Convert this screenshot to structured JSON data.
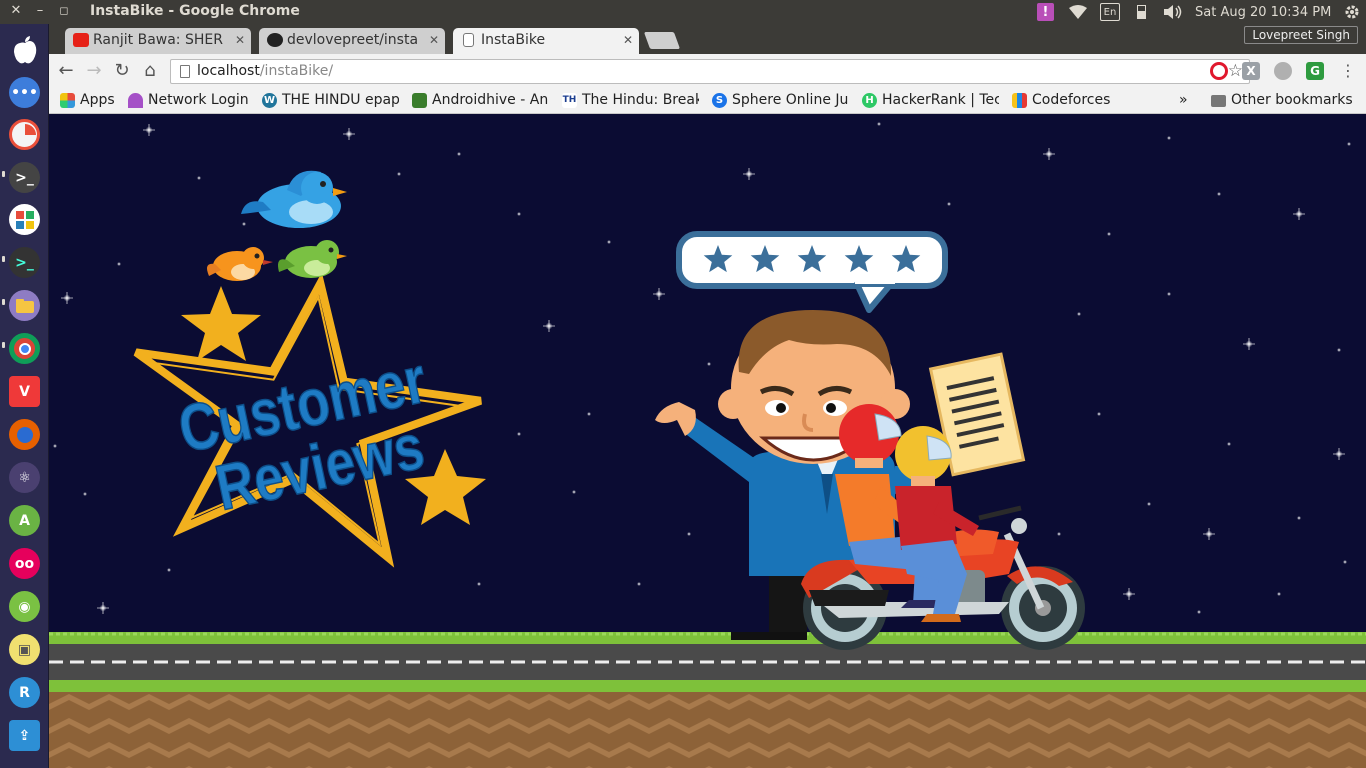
{
  "system": {
    "window_title": "InstaBike - Google Chrome",
    "indicator_alert": "!",
    "keyboard_layout": "En",
    "clock": "Sat Aug 20 10:34 PM"
  },
  "launcher": {
    "apps": [
      "apple-logo",
      "more-apps",
      "pie-app",
      "terminal",
      "app-grid",
      "terminal-alt",
      "files",
      "chrome",
      "vivaldi",
      "firefox",
      "atom",
      "android-studio",
      "flickr",
      "robot-app",
      "image-viewer",
      "refresh-app",
      "upload-app"
    ]
  },
  "tabs": [
    {
      "title": "Ranjit Bawa: SHER",
      "icon": "youtube-icon",
      "active": false
    },
    {
      "title": "devlovepreet/insta",
      "icon": "github-icon",
      "active": false
    },
    {
      "title": "InstaBike",
      "icon": "page-icon",
      "active": true
    }
  ],
  "profile_name": "Lovepreet Singh",
  "toolbar": {
    "url_host": "localhost",
    "url_path": "/instaBike/"
  },
  "bookmarks": [
    {
      "label": "Apps",
      "icon": "apps-grid-icon"
    },
    {
      "label": "Network Login",
      "icon": "umbrella-icon"
    },
    {
      "label": "THE HINDU epap",
      "icon": "wordpress-icon"
    },
    {
      "label": "Androidhive - An",
      "icon": "androidhive-icon"
    },
    {
      "label": "The Hindu: Break",
      "icon": "the-hindu-icon"
    },
    {
      "label": "Sphere Online Ju",
      "icon": "spoj-icon"
    },
    {
      "label": "HackerRank | Tec",
      "icon": "hackerrank-icon"
    },
    {
      "label": "Codeforces",
      "icon": "codeforces-icon"
    }
  ],
  "bookmarks_overflow": "»",
  "other_bookmarks": "Other bookmarks",
  "scene": {
    "heading_line1": "Customer",
    "heading_line2": "Reviews",
    "rating_stars": 5,
    "colors": {
      "sky": "#0b0c33",
      "heading_blue": "#1e7bc4",
      "star_gold": "#f2b01e",
      "grass": "#7ec13a",
      "road": "#4a4a4a",
      "dirt": "#8d6238"
    }
  }
}
